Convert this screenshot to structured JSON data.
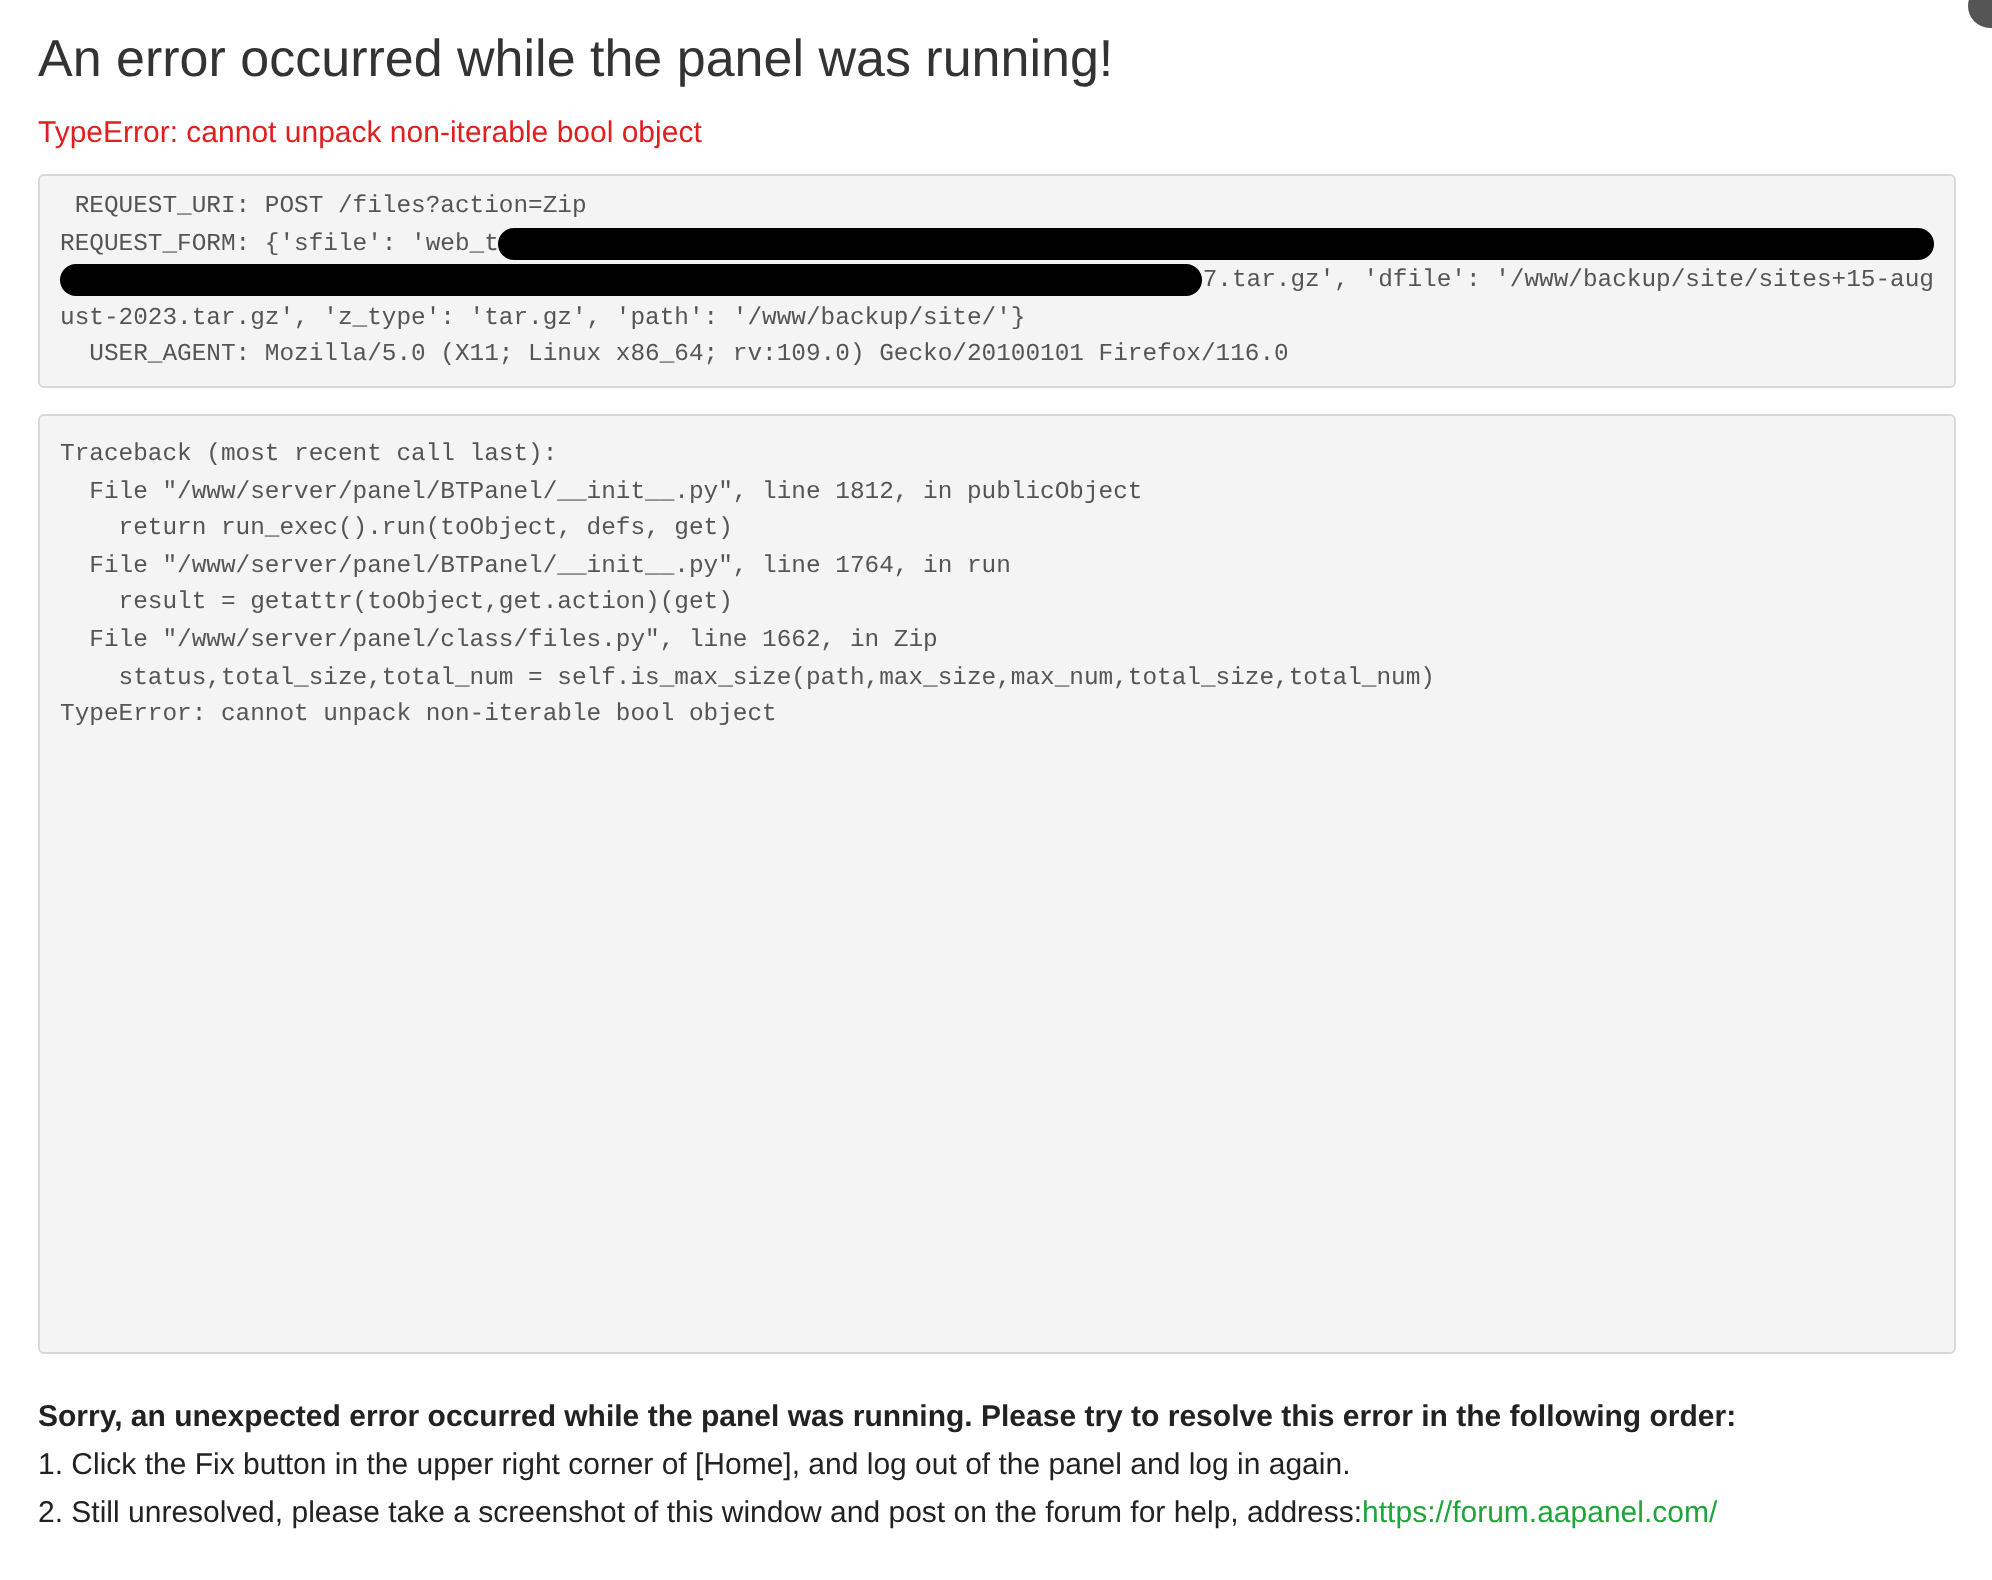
{
  "title": "An error occurred while the panel was running!",
  "error": "TypeError: cannot unpack non-iterable bool object",
  "request_lines": [
    [
      {
        "kind": "text",
        "text": " REQUEST_URI: POST /files?action=Zip"
      }
    ],
    [
      {
        "kind": "text",
        "text": "REQUEST_FORM: {'sfile': 'web_t"
      },
      {
        "kind": "redaction"
      }
    ],
    [
      {
        "kind": "redaction"
      },
      {
        "kind": "text",
        "text": "7.tar.gz', 'dfile': '/www/backup/site/sites+15-aug"
      }
    ],
    [
      {
        "kind": "text",
        "text": "ust-2023.tar.gz', 'z_type': 'tar.gz', 'path': '/www/backup/site/'}"
      }
    ],
    [
      {
        "kind": "text",
        "text": "  USER_AGENT: Mozilla/5.0 (X11; Linux x86_64; rv:109.0) Gecko/20100101 Firefox/116.0"
      }
    ]
  ],
  "traceback": [
    "Traceback (most recent call last):",
    "  File \"/www/server/panel/BTPanel/__init__.py\", line 1812, in publicObject",
    "    return run_exec().run(toObject, defs, get)",
    "  File \"/www/server/panel/BTPanel/__init__.py\", line 1764, in run",
    "    result = getattr(toObject,get.action)(get)",
    "  File \"/www/server/panel/class/files.py\", line 1662, in Zip",
    "    status,total_size,total_num = self.is_max_size(path,max_size,max_num,total_size,total_num)",
    "TypeError: cannot unpack non-iterable bool object"
  ],
  "help": {
    "heading": "Sorry, an unexpected error occurred while the panel was running. Please try to resolve this error in the following order:",
    "steps": [
      "1. Click the Fix button in the upper right corner of [Home], and log out of the panel and log in again.",
      "2. Still unresolved, please take a screenshot of this window and post on the forum for help, address:"
    ],
    "link": "https://forum.aapanel.com/"
  }
}
